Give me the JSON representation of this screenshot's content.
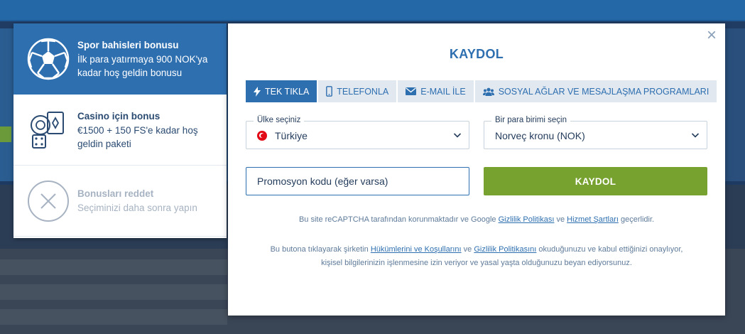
{
  "bonuses": [
    {
      "title": "Spor bahisleri bonusu",
      "desc": "İlk para yatırmaya 900 NOK'ya kadar hoş geldin bonusu",
      "icon": "soccer-ball-icon",
      "active": true
    },
    {
      "title": "Casino için bonus",
      "desc": "€1500 + 150 FS'e kadar hoş geldin paketi",
      "icon": "casino-chips-icon",
      "active": false
    },
    {
      "title": "Bonusları reddet",
      "desc": "Seçiminizi daha sonra yapın",
      "icon": "decline-x-icon",
      "active": false
    }
  ],
  "modal": {
    "title": "KAYDOL",
    "close_symbol": "×",
    "tabs": [
      {
        "label": "TEK TIKLA",
        "icon": "lightning-icon"
      },
      {
        "label": "TELEFONLA",
        "icon": "phone-icon"
      },
      {
        "label": "E-MAIL İLE",
        "icon": "envelope-icon"
      },
      {
        "label": "SOSYAL AĞLAR VE MESAJLAŞMA PROGRAMLARI",
        "icon": "people-icon"
      }
    ],
    "country": {
      "label": "Ülke seçiniz",
      "value": "Türkiye"
    },
    "currency": {
      "label": "Bir para birimi seçin",
      "value": "Norveç kronu (NOK)"
    },
    "promo_placeholder": "Promosyon kodu (eğer varsa)",
    "submit_label": "KAYDOL",
    "recaptcha": {
      "pre": "Bu site reCAPTCHA tarafından korunmaktadır ve Google ",
      "link1": "Gizlilik Politikası",
      "mid": " ve ",
      "link2": "Hizmet Şartları",
      "post": " geçerlidir."
    },
    "terms": {
      "pre": "Bu butona tıklayarak şirketin ",
      "link1": "Hükümlerini ve Koşullarını",
      "mid": " ve ",
      "link2": "Gizlilik Politikasını",
      "post": " okuduğunuzu ve kabul ettiğinizi onaylıyor,",
      "line2": "kişisel bilgilerinizin işlenmesine izin veriyor ve yasal yaşta olduğunuzu beyan ediyorsunuz."
    }
  },
  "colors": {
    "accent": "#2e6fb0",
    "submit": "#78a22f"
  }
}
